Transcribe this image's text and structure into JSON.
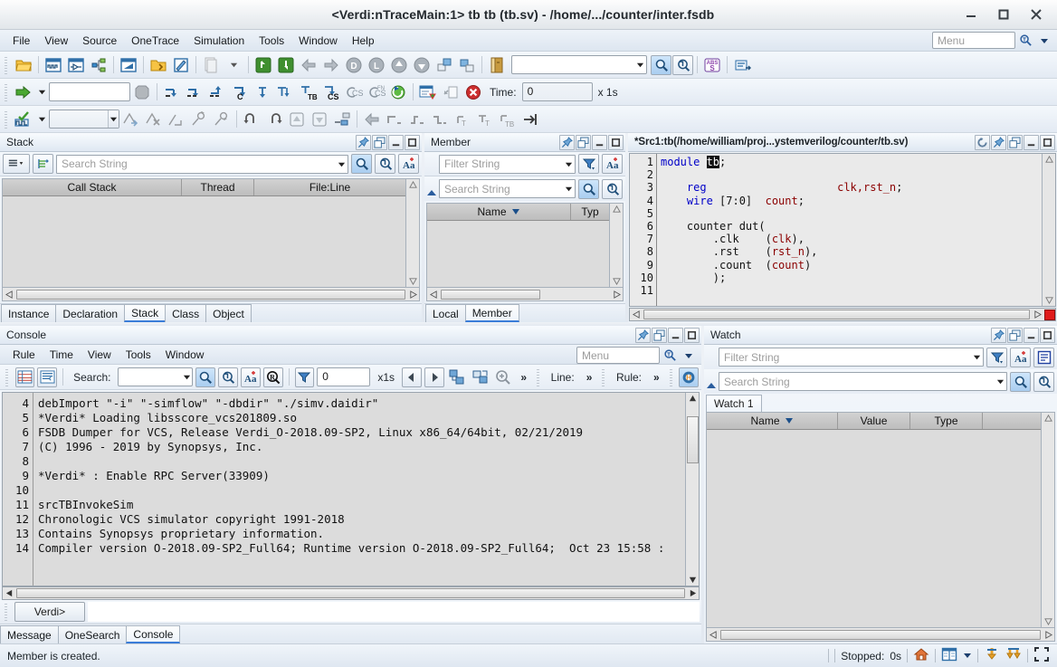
{
  "window": {
    "title": "<Verdi:nTraceMain:1> tb tb (tb.sv) - /home/.../counter/inter.fsdb",
    "minimize": "minimize-button",
    "maximize": "maximize-button",
    "close": "close-button"
  },
  "menubar": {
    "items": [
      {
        "label": "File"
      },
      {
        "label": "View"
      },
      {
        "label": "Source"
      },
      {
        "label": "OneTrace"
      },
      {
        "label": "Simulation"
      },
      {
        "label": "Tools"
      },
      {
        "label": "Window"
      },
      {
        "label": "Help"
      }
    ],
    "search_placeholder": "Menu"
  },
  "toolbar_row2": {
    "combo_value": "",
    "time_label": "Time:",
    "time_value": "0",
    "time_unit": "x 1s"
  },
  "toolbar_row3": {
    "combo_value": ""
  },
  "toolbar_row1": {
    "combo_value": ""
  },
  "stack_panel": {
    "title": "Stack",
    "search_placeholder": "Search String",
    "columns": [
      "Call Stack",
      "Thread",
      "File:Line"
    ],
    "rows": [],
    "tabs": [
      {
        "label": "Instance",
        "active": false
      },
      {
        "label": "Declaration",
        "active": false
      },
      {
        "label": "Stack",
        "active": true
      },
      {
        "label": "Class",
        "active": false
      },
      {
        "label": "Object",
        "active": false
      }
    ]
  },
  "member_panel": {
    "title": "Member",
    "filter_placeholder": "Filter String",
    "search_placeholder": "Search String",
    "columns": [
      "Name",
      "Typ"
    ],
    "rows": [],
    "tabs": [
      {
        "label": "Local",
        "active": false
      },
      {
        "label": "Member",
        "active": true
      }
    ]
  },
  "source_panel": {
    "title": "*Src1:tb(/home/william/proj...ystemverilog/counter/tb.sv)",
    "lines": [
      {
        "no": "1",
        "tokens": [
          {
            "t": "module ",
            "c": "kw"
          },
          {
            "t": "tb",
            "c": "sel"
          },
          {
            "t": ";",
            "c": "plain"
          }
        ]
      },
      {
        "no": "2",
        "tokens": []
      },
      {
        "no": "3",
        "tokens": [
          {
            "t": "    ",
            "c": "plain"
          },
          {
            "t": "reg",
            "c": "kw"
          },
          {
            "t": "                    ",
            "c": "plain"
          },
          {
            "t": "clk,rst_n",
            "c": "id"
          },
          {
            "t": ";",
            "c": "plain"
          }
        ]
      },
      {
        "no": "4",
        "tokens": [
          {
            "t": "    ",
            "c": "plain"
          },
          {
            "t": "wire",
            "c": "kw"
          },
          {
            "t": " [7:0]  ",
            "c": "plain"
          },
          {
            "t": "count",
            "c": "id"
          },
          {
            "t": ";",
            "c": "plain"
          }
        ]
      },
      {
        "no": "5",
        "tokens": []
      },
      {
        "no": "6",
        "tokens": [
          {
            "t": "    counter dut(",
            "c": "plain"
          }
        ]
      },
      {
        "no": "7",
        "tokens": [
          {
            "t": "        .clk    (",
            "c": "plain"
          },
          {
            "t": "clk",
            "c": "id"
          },
          {
            "t": "),",
            "c": "plain"
          }
        ]
      },
      {
        "no": "8",
        "tokens": [
          {
            "t": "        .rst    (",
            "c": "plain"
          },
          {
            "t": "rst_n",
            "c": "id"
          },
          {
            "t": "),",
            "c": "plain"
          }
        ]
      },
      {
        "no": "9",
        "tokens": [
          {
            "t": "        .count  (",
            "c": "plain"
          },
          {
            "t": "count",
            "c": "id"
          },
          {
            "t": ")",
            "c": "plain"
          }
        ]
      },
      {
        "no": "10",
        "tokens": [
          {
            "t": "        );",
            "c": "plain"
          }
        ]
      },
      {
        "no": "11",
        "tokens": []
      }
    ]
  },
  "console_panel": {
    "title": "Console",
    "menu": [
      {
        "label": "Rule"
      },
      {
        "label": "Time"
      },
      {
        "label": "View"
      },
      {
        "label": "Tools"
      },
      {
        "label": "Window"
      }
    ],
    "menu_search_placeholder": "Menu",
    "search_label": "Search:",
    "search_value": "",
    "filter_value": "0",
    "time_unit": "x1s",
    "line_label": "Line:",
    "rule_label": "Rule:",
    "more": "»",
    "lines": [
      {
        "no": "4",
        "text": "debImport \"-i\" \"-simflow\" \"-dbdir\" \"./simv.daidir\""
      },
      {
        "no": "5",
        "text": "*Verdi* Loading libsscore_vcs201809.so"
      },
      {
        "no": "6",
        "text": "FSDB Dumper for VCS, Release Verdi_O-2018.09-SP2, Linux x86_64/64bit, 02/21/2019"
      },
      {
        "no": "7",
        "text": "(C) 1996 - 2019 by Synopsys, Inc."
      },
      {
        "no": "8",
        "text": ""
      },
      {
        "no": "9",
        "text": "*Verdi* : Enable RPC Server(33909)"
      },
      {
        "no": "10",
        "text": ""
      },
      {
        "no": "11",
        "text": "srcTBInvokeSim"
      },
      {
        "no": "12",
        "text": "Chronologic VCS simulator copyright 1991-2018"
      },
      {
        "no": "13",
        "text": "Contains Synopsys proprietary information."
      },
      {
        "no": "14",
        "text": "Compiler version O-2018.09-SP2_Full64; Runtime version O-2018.09-SP2_Full64;  Oct 23 15:58 :"
      }
    ],
    "prompt_label": "Verdi>",
    "prompt_value": ""
  },
  "watch_panel": {
    "title": "Watch",
    "filter_placeholder": "Filter String",
    "search_placeholder": "Search String",
    "tab_label": "Watch 1",
    "columns": [
      "Name",
      "Value",
      "Type"
    ],
    "rows": []
  },
  "bottom_tabs": [
    {
      "label": "Message",
      "active": false
    },
    {
      "label": "OneSearch",
      "active": false
    },
    {
      "label": "Console",
      "active": true
    }
  ],
  "statusbar": {
    "message": "Member is created.",
    "stopped_label": "Stopped:",
    "stopped_value": "0s"
  },
  "colors": {
    "accent": "#3b7dd8",
    "keyword": "#0000c8",
    "identifier": "#8b0000",
    "error": "#e01b1b",
    "panel_bg": "#dcdcdc"
  }
}
